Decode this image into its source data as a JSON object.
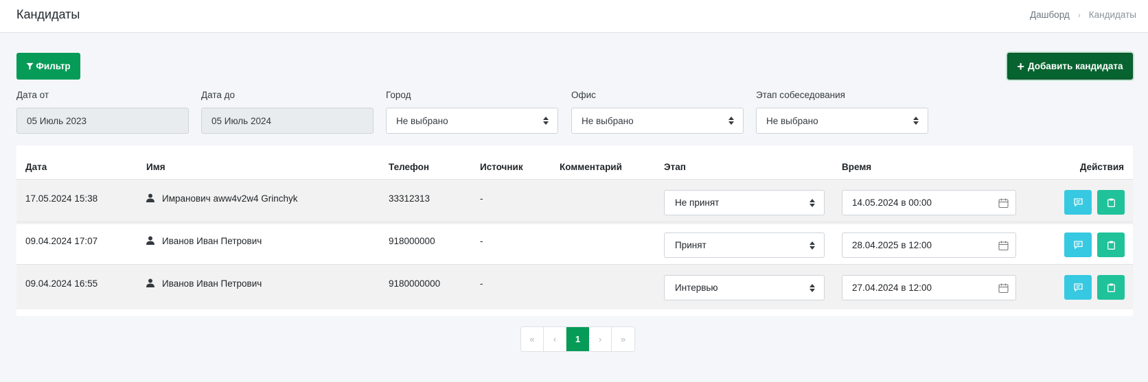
{
  "header": {
    "title": "Кандидаты",
    "breadcrumb": [
      "Дашборд",
      "Кандидаты"
    ]
  },
  "toolbar": {
    "filter_label": "Фильтр",
    "add_label": "Добавить кандидата"
  },
  "filters": {
    "date_from": {
      "label": "Дата от",
      "value": "05 Июль 2023"
    },
    "date_to": {
      "label": "Дата до",
      "value": "05 Июль 2024"
    },
    "city": {
      "label": "Город",
      "value": "Не выбрано"
    },
    "office": {
      "label": "Офис",
      "value": "Не выбрано"
    },
    "stage": {
      "label": "Этап собеседования",
      "value": "Не выбрано"
    }
  },
  "table": {
    "columns": [
      "Дата",
      "Имя",
      "Телефон",
      "Источник",
      "Комментарий",
      "Этап",
      "Время",
      "Действия"
    ],
    "rows": [
      {
        "date": "17.05.2024 15:38",
        "name": "Имранович aww4v2w4 Grinchyk",
        "phone": "33312313",
        "source": "-",
        "comment": "",
        "stage": "Не принят",
        "time": "14.05.2024 в 00:00"
      },
      {
        "date": "09.04.2024 17:07",
        "name": "Иванов Иван Петрович",
        "phone": "918000000",
        "source": "-",
        "comment": "",
        "stage": "Принят",
        "time": "28.04.2025 в 12:00"
      },
      {
        "date": "09.04.2024 16:55",
        "name": "Иванов Иван Петрович",
        "phone": "9180000000",
        "source": "-",
        "comment": "",
        "stage": "Интервью",
        "time": "27.04.2024 в 12:00"
      }
    ]
  },
  "pagination": {
    "first": "«",
    "prev": "‹",
    "current": "1",
    "next": "›",
    "last": "»"
  },
  "colors": {
    "primary_green": "#079b58",
    "dark_green": "#07632f",
    "info": "#37c9e1",
    "teal": "#20c29a"
  }
}
